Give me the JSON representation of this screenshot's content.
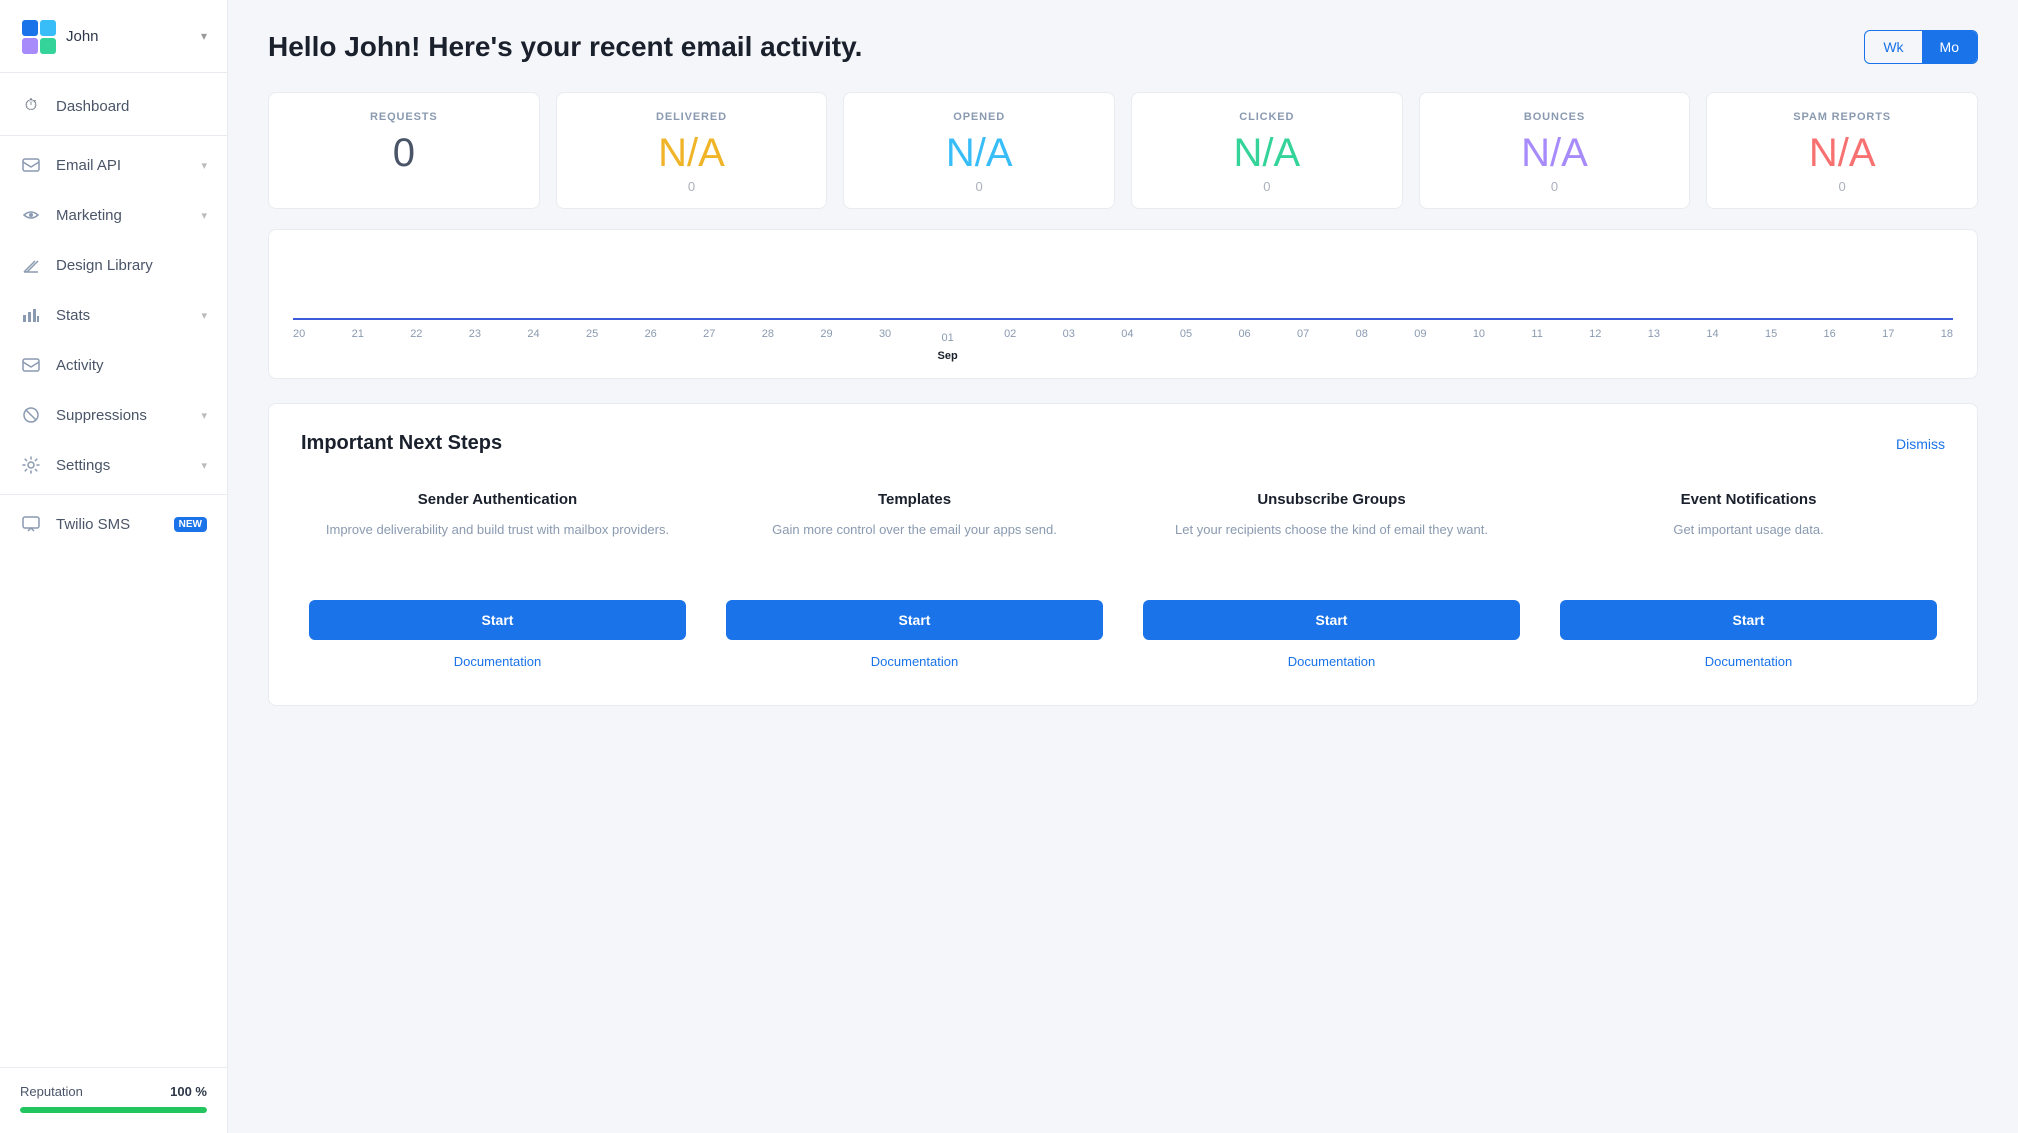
{
  "sidebar": {
    "user": {
      "name": "John",
      "chevron": "▾"
    },
    "nav_items": [
      {
        "id": "dashboard",
        "label": "Dashboard",
        "icon": "⏱",
        "has_chevron": false
      },
      {
        "id": "email-api",
        "label": "Email API",
        "icon": "◻",
        "has_chevron": true
      },
      {
        "id": "marketing",
        "label": "Marketing",
        "icon": "📢",
        "has_chevron": true
      },
      {
        "id": "design-library",
        "label": "Design Library",
        "icon": "✏",
        "has_chevron": false
      },
      {
        "id": "stats",
        "label": "Stats",
        "icon": "📊",
        "has_chevron": true
      },
      {
        "id": "activity",
        "label": "Activity",
        "icon": "✉",
        "has_chevron": false
      },
      {
        "id": "suppressions",
        "label": "Suppressions",
        "icon": "🚫",
        "has_chevron": true
      },
      {
        "id": "settings",
        "label": "Settings",
        "icon": "⚙",
        "has_chevron": true
      },
      {
        "id": "twilio-sms",
        "label": "Twilio SMS",
        "badge": "NEW",
        "icon": "💬",
        "has_chevron": false
      }
    ],
    "reputation": {
      "label": "Reputation",
      "value": "100 %",
      "percent": 100
    }
  },
  "header": {
    "title": "Hello John! Here's your recent email activity.",
    "period_buttons": [
      {
        "id": "wk",
        "label": "Wk",
        "active": false
      },
      {
        "id": "mo",
        "label": "Mo",
        "active": true
      }
    ]
  },
  "stats": [
    {
      "id": "requests",
      "label": "REQUESTS",
      "value": "0",
      "sub": "",
      "color_class": "color-requests"
    },
    {
      "id": "delivered",
      "label": "DELIVERED",
      "value": "N/A",
      "sub": "0",
      "color_class": "color-delivered"
    },
    {
      "id": "opened",
      "label": "OPENED",
      "value": "N/A",
      "sub": "0",
      "color_class": "color-opened"
    },
    {
      "id": "clicked",
      "label": "CLICKED",
      "value": "N/A",
      "sub": "0",
      "color_class": "color-clicked"
    },
    {
      "id": "bounces",
      "label": "BOUNCES",
      "value": "N/A",
      "sub": "0",
      "color_class": "color-bounces"
    },
    {
      "id": "spam-reports",
      "label": "SPAM REPORTS",
      "value": "N/A",
      "sub": "0",
      "color_class": "color-spam"
    }
  ],
  "chart": {
    "axis_labels": [
      "20",
      "21",
      "22",
      "23",
      "24",
      "25",
      "26",
      "27",
      "28",
      "29",
      "30",
      "01",
      "02",
      "03",
      "04",
      "05",
      "06",
      "07",
      "08",
      "09",
      "10",
      "11",
      "12",
      "13",
      "14",
      "15",
      "16",
      "17",
      "18"
    ],
    "sep_label": "Sep",
    "sep_index": 11
  },
  "next_steps": {
    "title": "Important Next Steps",
    "dismiss_label": "Dismiss",
    "steps": [
      {
        "id": "sender-auth",
        "title": "Sender Authentication",
        "description": "Improve deliverability and build trust with mailbox providers.",
        "start_label": "Start",
        "doc_label": "Documentation"
      },
      {
        "id": "templates",
        "title": "Templates",
        "description": "Gain more control over the email your apps send.",
        "start_label": "Start",
        "doc_label": "Documentation"
      },
      {
        "id": "unsubscribe-groups",
        "title": "Unsubscribe Groups",
        "description": "Let your recipients choose the kind of email they want.",
        "start_label": "Start",
        "doc_label": "Documentation"
      },
      {
        "id": "event-notifications",
        "title": "Event Notifications",
        "description": "Get important usage data.",
        "start_label": "Start",
        "doc_label": "Documentation"
      }
    ]
  }
}
